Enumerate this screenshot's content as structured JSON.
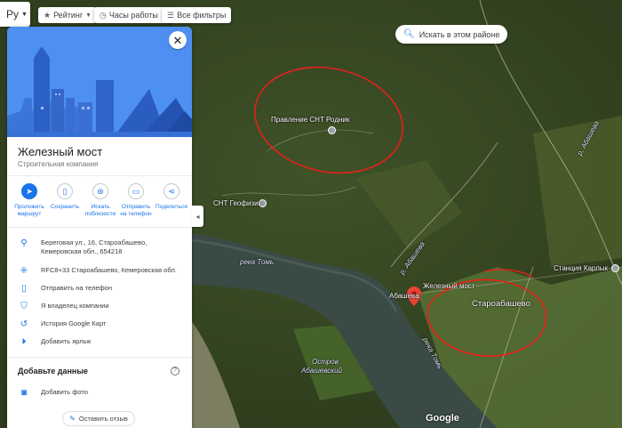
{
  "map": {
    "labels": {
      "snt_rodnik": "Правление СНТ Родник",
      "snt_geofizik": "СНТ Геофизик",
      "river_tom_1": "река Томь",
      "river_tom_2": "река Томь",
      "river_abasheva": "р. Абашева",
      "river_abasheva_2": "р. Абашева",
      "abasheva_short": "Абашева",
      "zhelezny_most": "Железный мост",
      "starobashevo": "Староабашево",
      "station_karlyk": "Станция Карлык",
      "island_line1": "Остров",
      "island_line2": "Абашевский"
    },
    "google_logo": "Google"
  },
  "toolbar": {
    "language": "Ру",
    "rating": "Рейтинг",
    "hours": "Часы работы",
    "filters": "Все фильтры",
    "search_area": "Искать в этом районе"
  },
  "place": {
    "name": "Железный мост",
    "category": "Строительная компания",
    "actions": [
      {
        "icon": "directions-icon",
        "label_line1": "Проложить",
        "label_line2": "маршрут"
      },
      {
        "icon": "bookmark-icon",
        "label_line1": "Сохранить",
        "label_line2": ""
      },
      {
        "icon": "nearby-icon",
        "label_line1": "Искать",
        "label_line2": "поблизости"
      },
      {
        "icon": "send-to-phone-icon",
        "label_line1": "Отправить",
        "label_line2": "на телефон"
      },
      {
        "icon": "share-icon",
        "label_line1": "Поделиться",
        "label_line2": ""
      }
    ],
    "address_line1": "Береговая ул., 16, Староабашево,",
    "address_line2": "Кемеровская обл., 654218",
    "plus_code": "RFC8+33 Староабашево, Кемеровская обл.",
    "send_to_phone": "Отправить на телефон",
    "claim_business": "Я владелец компании",
    "history": "История Google Карт",
    "add_label": "Добавить ярлык",
    "add_data_title": "Добавьте данные",
    "add_photo": "Добавить фото",
    "write_review": "Оставить отзыв"
  },
  "colors": {
    "accent": "#1a73e8",
    "pin": "#ea4335",
    "annotation": "#e8201a"
  }
}
